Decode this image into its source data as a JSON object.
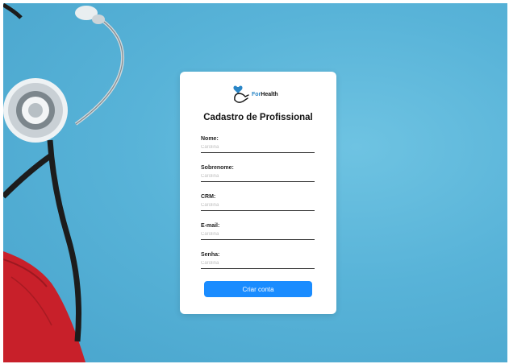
{
  "brand": {
    "name_part1": "For",
    "name_part2": "Health",
    "logo_icon": "hand-heart-icon"
  },
  "title": "Cadastro de Profissional",
  "fields": [
    {
      "label": "Nome:",
      "placeholder": "Carolina",
      "value": ""
    },
    {
      "label": "Sobrenome:",
      "placeholder": "Carolina",
      "value": ""
    },
    {
      "label": "CRM:",
      "placeholder": "Carolina",
      "value": ""
    },
    {
      "label": "E-mail:",
      "placeholder": "Carolina",
      "value": ""
    },
    {
      "label": "Senha:",
      "placeholder": "Carolina",
      "value": ""
    }
  ],
  "submit_label": "Criar conta",
  "colors": {
    "background": "#58b3d8",
    "accent": "#1a8cff",
    "brand_blue": "#2a86c7",
    "bag_red": "#c8202a"
  }
}
